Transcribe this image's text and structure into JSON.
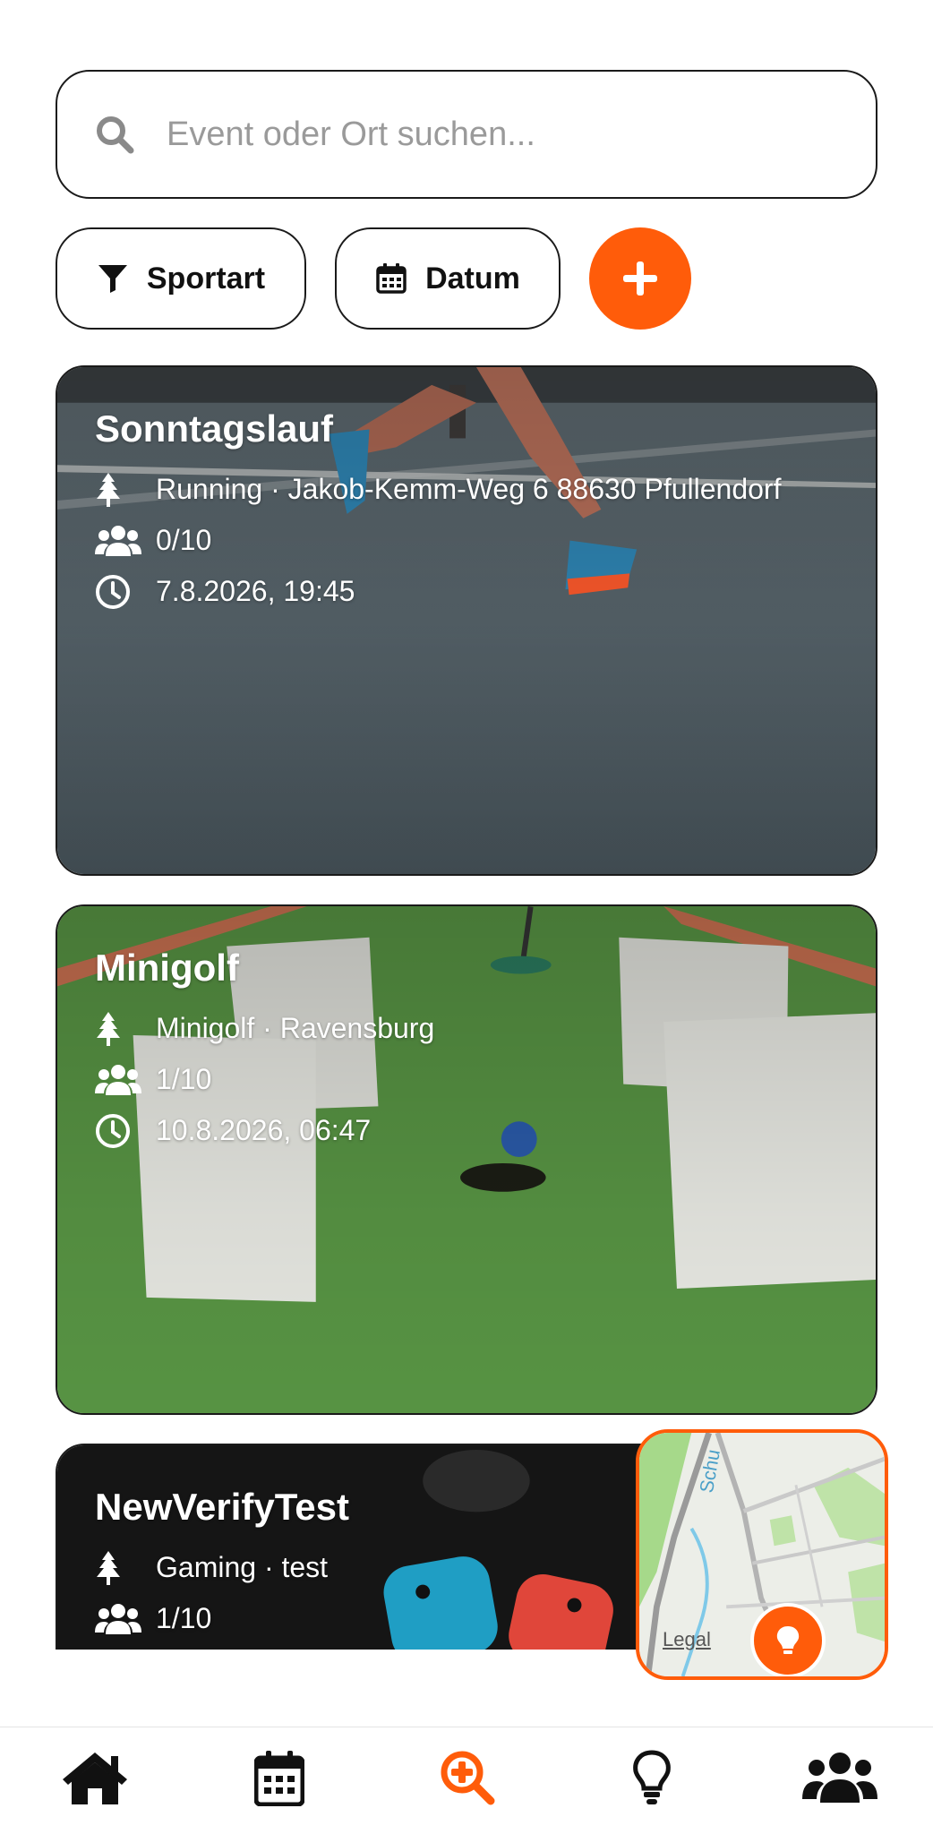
{
  "search": {
    "placeholder": "Event oder Ort suchen...",
    "value": ""
  },
  "filters": {
    "sport_label": "Sportart",
    "date_label": "Datum"
  },
  "events": [
    {
      "title": "Sonntagslauf",
      "sport_location": "Running · Jakob-Kemm-Weg 6 88630 Pfullendorf",
      "participants": "0/10",
      "datetime": "7.8.2026, 19:45"
    },
    {
      "title": "Minigolf",
      "sport_location": "Minigolf · Ravensburg",
      "participants": "1/10",
      "datetime": "10.8.2026, 06:47"
    },
    {
      "title": "NewVerifyTest",
      "sport_location": "Gaming · test",
      "participants": "1/10"
    }
  ],
  "map": {
    "legal_label": "Legal"
  },
  "nav": {
    "items": [
      "home-icon",
      "calendar-icon",
      "search-plus-icon",
      "lightbulb-icon",
      "users-icon"
    ],
    "active": "search-plus-icon"
  },
  "colors": {
    "accent": "#ff5c0a",
    "border": "#1a1a1a",
    "placeholder": "#9a9a9a"
  }
}
